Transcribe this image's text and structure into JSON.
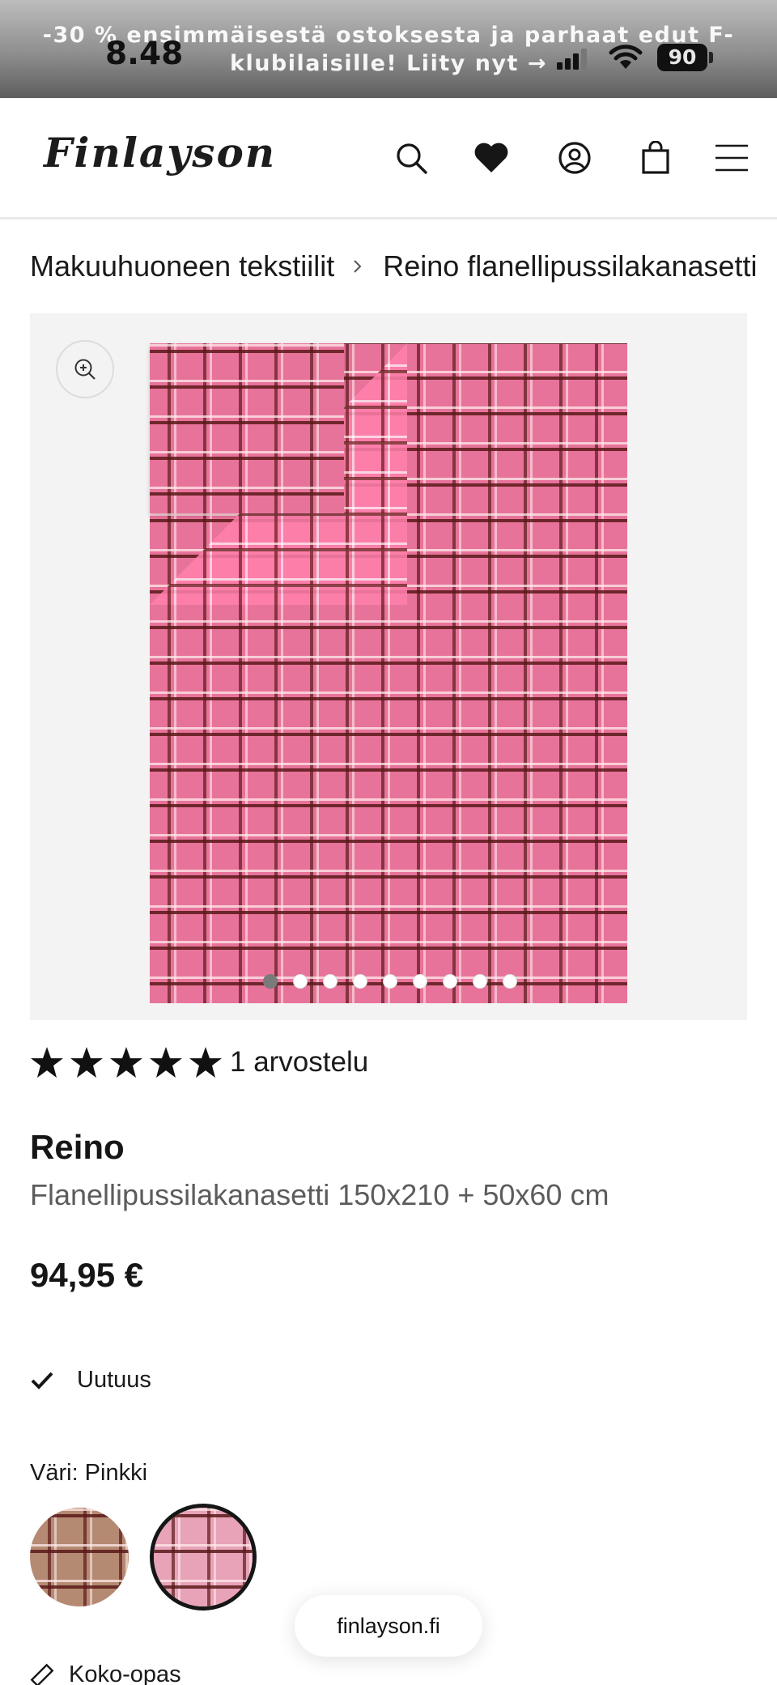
{
  "status_bar": {
    "time": "8.48",
    "battery": "90"
  },
  "promo": {
    "text": "-30 % ensimmäisestä ostoksesta ja parhaat edut F-klubilaisille! Liity nyt →"
  },
  "header": {
    "logo": "Finlayson",
    "icons": [
      "search-icon",
      "heart-icon",
      "account-icon",
      "bag-icon",
      "menu-icon"
    ]
  },
  "breadcrumb": {
    "items": [
      "Makuuhuoneen tekstiilit",
      "Reino flanellipussilakanasetti"
    ]
  },
  "gallery": {
    "image_count": 9,
    "active_index": 0,
    "main_color": "#e8739a"
  },
  "rating": {
    "stars": 5,
    "text": "1 arvostelu"
  },
  "product": {
    "name": "Reino",
    "description": "Flanellipussilakanasetti 150x210 + 50x60 cm",
    "price": "94,95 €",
    "badge": "Uutuus",
    "color_label": "Väri: Pinkki",
    "swatches": [
      {
        "name": "brown",
        "color": "#b58a72"
      },
      {
        "name": "pink",
        "color": "#e8739a"
      }
    ],
    "size_guide": "Koko-opas"
  },
  "browser": {
    "url": "finlayson.fi"
  }
}
